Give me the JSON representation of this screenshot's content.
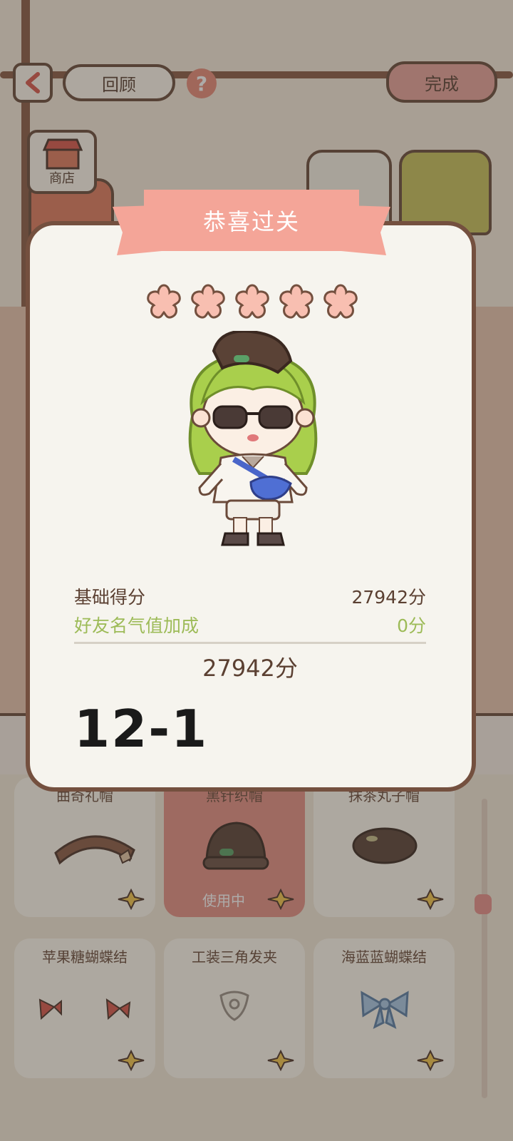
{
  "topbar": {
    "review_label": "回顾",
    "help_label": "?",
    "done_label": "完成",
    "shop_label": "商店"
  },
  "dialog": {
    "title": "恭喜过关",
    "stars": 5,
    "score": {
      "base_label": "基础得分",
      "base_value": "27942分",
      "bonus_label": "好友名气值加成",
      "bonus_value": "0分",
      "total": "27942分"
    },
    "level": "12-1"
  },
  "items": [
    {
      "name": "曲奇礼帽",
      "status": "",
      "icon": "hat-cookie-icon"
    },
    {
      "name": "黑针织帽",
      "status": "使用中",
      "icon": "knit-beanie-icon"
    },
    {
      "name": "抹茶丸子帽",
      "status": "",
      "icon": "beret-icon"
    },
    {
      "name": "苹果糖蝴蝶结",
      "status": "",
      "icon": "red-bow-icon"
    },
    {
      "name": "工装三角发夹",
      "status": "",
      "icon": "triangle-clip-icon"
    },
    {
      "name": "海蓝蓝蝴蝶结",
      "status": "",
      "icon": "blue-bow-icon"
    }
  ],
  "colors": {
    "accent": "#f4a598",
    "star": "#f8bfb1",
    "border": "#74503f",
    "bonus_text": "#9dbb58",
    "active_card": "#e58f84"
  }
}
